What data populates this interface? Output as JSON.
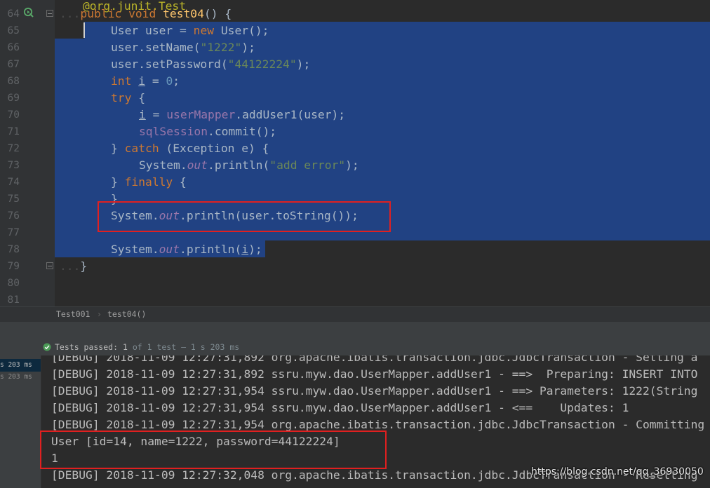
{
  "editor": {
    "line_numbers": [
      "64",
      "65",
      "66",
      "67",
      "68",
      "69",
      "70",
      "71",
      "72",
      "73",
      "74",
      "75",
      "76",
      "77",
      "78",
      "79",
      "80",
      "81"
    ],
    "partial_annotation": "@org.junit.Test",
    "method_decl": {
      "mod1": "public",
      "mod2": "void",
      "name": "test04",
      "rest": "() {"
    },
    "l65": {
      "type": "User",
      "var": " user = ",
      "kw": "new",
      "ctor": " User();"
    },
    "l66": {
      "pre": "user.setName(",
      "str": "\"1222\"",
      "post": ");"
    },
    "l67": {
      "pre": "user.setPassword(",
      "str": "\"44122224\"",
      "post": ");"
    },
    "l68": {
      "kw": "int",
      "var": "i",
      "mid": " = ",
      "num": "0",
      "end": ";"
    },
    "l69": {
      "kw": "try",
      "rest": " {"
    },
    "l70": {
      "var": "i",
      "mid": " = ",
      "field": "userMapper",
      "call": ".addUser1(user);"
    },
    "l71": {
      "field": "sqlSession",
      "call": ".commit();"
    },
    "l72": {
      "b1": "} ",
      "kw": "catch",
      "rest": " (Exception e) {"
    },
    "l73": {
      "pre": "System.",
      "out": "out",
      "mid": ".println(",
      "str": "\"add error\"",
      "post": ");"
    },
    "l74": {
      "b1": "} ",
      "kw": "finally",
      "rest": " {"
    },
    "l75": {
      "text": "}"
    },
    "l76": {
      "pre": "System.",
      "out": "out",
      "post": ".println(user.toString());"
    },
    "l78": {
      "pre": "System.",
      "out": "out",
      "mid": ".println(",
      "var": "i",
      "post": ");"
    },
    "l79": {
      "text": "}"
    }
  },
  "breadcrumb": {
    "class_name": "Test001",
    "separator": "›",
    "method": "test04()"
  },
  "test_bar": {
    "status_label": "Tests passed:",
    "passed": "1",
    "of_text": "of 1 test",
    "duration": "– 1 s 203 ms"
  },
  "test_tree": {
    "rows": [
      {
        "text": "s 203 ms"
      },
      {
        "text": "s 203 ms"
      }
    ]
  },
  "console": {
    "lines": [
      "[DEBUG] 2018-11-09 12:27:31,892 org.apache.ibatis.transaction.jdbc.JdbcTransaction - Setting a",
      "[DEBUG] 2018-11-09 12:27:31,892 ssru.myw.dao.UserMapper.addUser1 - ==>  Preparing: INSERT INTO",
      "[DEBUG] 2018-11-09 12:27:31,954 ssru.myw.dao.UserMapper.addUser1 - ==> Parameters: 1222(String",
      "[DEBUG] 2018-11-09 12:27:31,954 ssru.myw.dao.UserMapper.addUser1 - <==    Updates: 1",
      "[DEBUG] 2018-11-09 12:27:31,954 org.apache.ibatis.transaction.jdbc.JdbcTransaction - Committing",
      "User [id=14, name=1222, password=44122224]",
      "1",
      "[DEBUG] 2018-11-09 12:27:32,048 org.apache.ibatis.transaction.jdbc.JdbcTransaction - Resetting"
    ]
  },
  "watermark": "https://blog.csdn.net/qq_36930050",
  "colors": {
    "selection": "#214283",
    "highlight_box": "#e02020",
    "keyword": "#cc7832",
    "string": "#6a8759"
  }
}
